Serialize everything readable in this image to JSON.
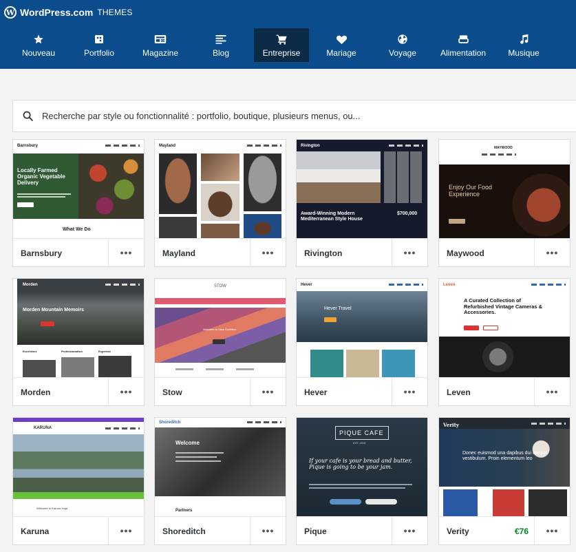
{
  "topbar": {
    "brand": "WordPress.com",
    "section": "THEMES"
  },
  "nav": [
    {
      "label": "Nouveau",
      "icon": "star-icon"
    },
    {
      "label": "Portfolio",
      "icon": "portfolio-icon"
    },
    {
      "label": "Magazine",
      "icon": "magazine-icon"
    },
    {
      "label": "Blog",
      "icon": "blog-icon"
    },
    {
      "label": "Entreprise",
      "icon": "cart-icon",
      "active": true
    },
    {
      "label": "Mariage",
      "icon": "heart-icon"
    },
    {
      "label": "Voyage",
      "icon": "globe-icon"
    },
    {
      "label": "Alimentation",
      "icon": "food-icon"
    },
    {
      "label": "Musique",
      "icon": "music-icon"
    }
  ],
  "search": {
    "placeholder": "Recherche par style ou fonctionnalité : portfolio, boutique, plusieurs menus, ou..."
  },
  "themes": [
    {
      "name": "Barnsbury",
      "price": ""
    },
    {
      "name": "Mayland",
      "price": ""
    },
    {
      "name": "Rivington",
      "price": ""
    },
    {
      "name": "Maywood",
      "price": ""
    },
    {
      "name": "Morden",
      "price": ""
    },
    {
      "name": "Stow",
      "price": ""
    },
    {
      "name": "Hever",
      "price": ""
    },
    {
      "name": "Leven",
      "price": ""
    },
    {
      "name": "Karuna",
      "price": ""
    },
    {
      "name": "Shoreditch",
      "price": ""
    },
    {
      "name": "Pique",
      "price": ""
    },
    {
      "name": "Verity",
      "price": "€76"
    }
  ],
  "previews": {
    "barnsbury": {
      "logo": "Barnsbury",
      "headline": "Locally Farmed Organic Vegetable Delivery",
      "footer": "What We Do"
    },
    "mayland": {
      "logo": "Mayland"
    },
    "rivington": {
      "logo": "Rivington",
      "headline": "Award-Winning Modern Mediterranean Style House",
      "price": "$700,000"
    },
    "maywood": {
      "logo": "MAYWOOD",
      "headline": "Enjoy Our Food Experience"
    },
    "morden": {
      "logo": "Morden",
      "headline": "Morden Mountain Memoirs",
      "cols": [
        "Excellence",
        "Professionalism",
        "Expertise"
      ]
    },
    "stow": {
      "logo": "STOW",
      "headline": "Welcome to Stow Outfitters"
    },
    "hever": {
      "logo": "Hever",
      "headline": "Hever Travel"
    },
    "leven": {
      "logo": "Leven",
      "headline": "A Curated Collection of Refurbished Vintage Cameras & Accessories."
    },
    "karuna": {
      "logo": "KARUNA",
      "footer": "Welcome to Karuna Yoga"
    },
    "shoreditch": {
      "logo": "Shoreditch",
      "headline": "Welcome",
      "footer": "Partners"
    },
    "pique": {
      "logo": "PIQUE CAFE",
      "sub": "EST. 2016",
      "headline": "If your cafe is your bread and butter, Pique is going to be your jam."
    },
    "verity": {
      "logo": "Verity",
      "headline": "Donec euismod una dapibus dui tempor vestibulum. Proin elementum leo"
    }
  },
  "colors": {
    "nav_bg": "#0b4c8c",
    "nav_active": "#0a2a45",
    "price": "#008a20"
  }
}
